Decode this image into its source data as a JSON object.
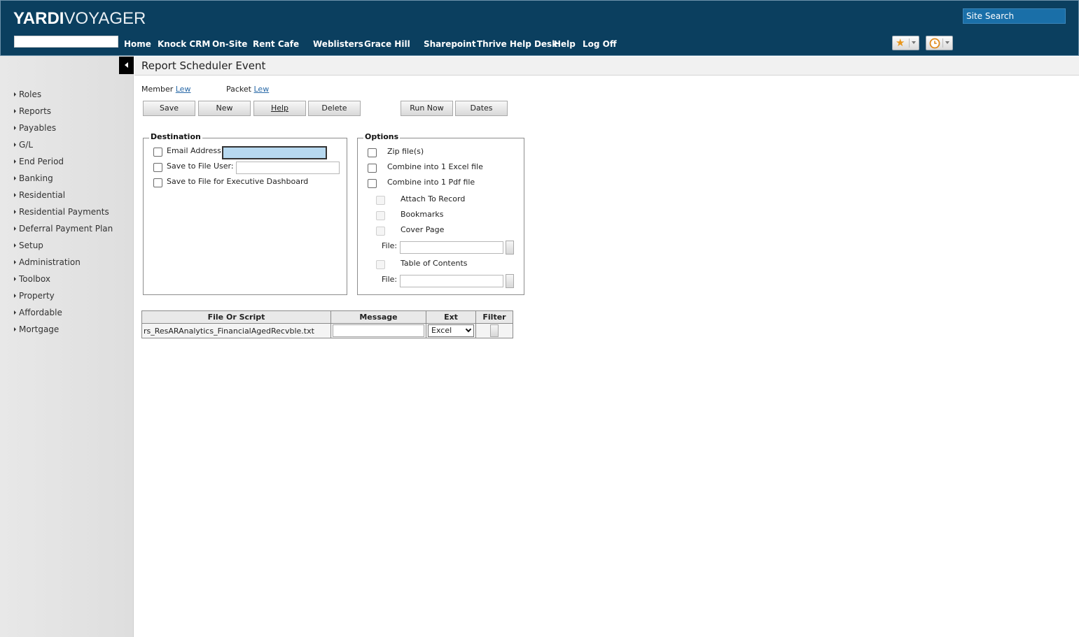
{
  "header": {
    "logo_bold": "YARDI",
    "logo_light": "VOYAGER",
    "site_search": "Site Search",
    "nav": [
      "Home",
      "Knock CRM",
      "On-Site",
      "Rent Cafe",
      "Weblisters",
      "Grace Hill",
      "Sharepoint",
      "Thrive Help Desk",
      "Help",
      "Log Off"
    ],
    "favorites_icon": "star-icon",
    "history_icon": "clock-icon"
  },
  "sidebar": {
    "items": [
      "Roles",
      "Reports",
      "Payables",
      "G/L",
      "End Period",
      "Banking",
      "Residential",
      "Residential Payments",
      "Deferral Payment Plan",
      "Setup",
      "Administration",
      "Toolbox",
      "Property",
      "Affordable",
      "Mortgage"
    ]
  },
  "page": {
    "title": "Report Scheduler Event",
    "member_label": "Member",
    "member_value": "Lew",
    "packet_label": "Packet",
    "packet_value": "Lew"
  },
  "toolbar": {
    "save": "Save",
    "new": "New",
    "help": "Help",
    "delete": "Delete",
    "run_now": "Run Now",
    "dates": "Dates"
  },
  "destination": {
    "legend": "Destination",
    "email": "Email Address",
    "save_user": "Save to File User:",
    "save_exec": "Save to File for Executive Dashboard"
  },
  "options": {
    "legend": "Options",
    "zip": "Zip file(s)",
    "combine_excel": "Combine into 1 Excel file",
    "combine_pdf": "Combine into 1 Pdf file",
    "attach": "Attach To Record",
    "bookmarks": "Bookmarks",
    "cover": "Cover Page",
    "file_label": "File:",
    "toc": "Table of Contents",
    "file_label2": "File:"
  },
  "grid": {
    "headers": [
      "File Or Script",
      "Message",
      "Ext",
      "Filter"
    ],
    "rows": [
      {
        "file": "rs_ResARAnalytics_FinancialAgedRecvble.txt",
        "message": "",
        "ext": "Excel"
      }
    ]
  },
  "colors": {
    "header_bg": "#0b3f5f",
    "site_search_bg": "#1a6fa8",
    "link": "#2a6aa8"
  }
}
